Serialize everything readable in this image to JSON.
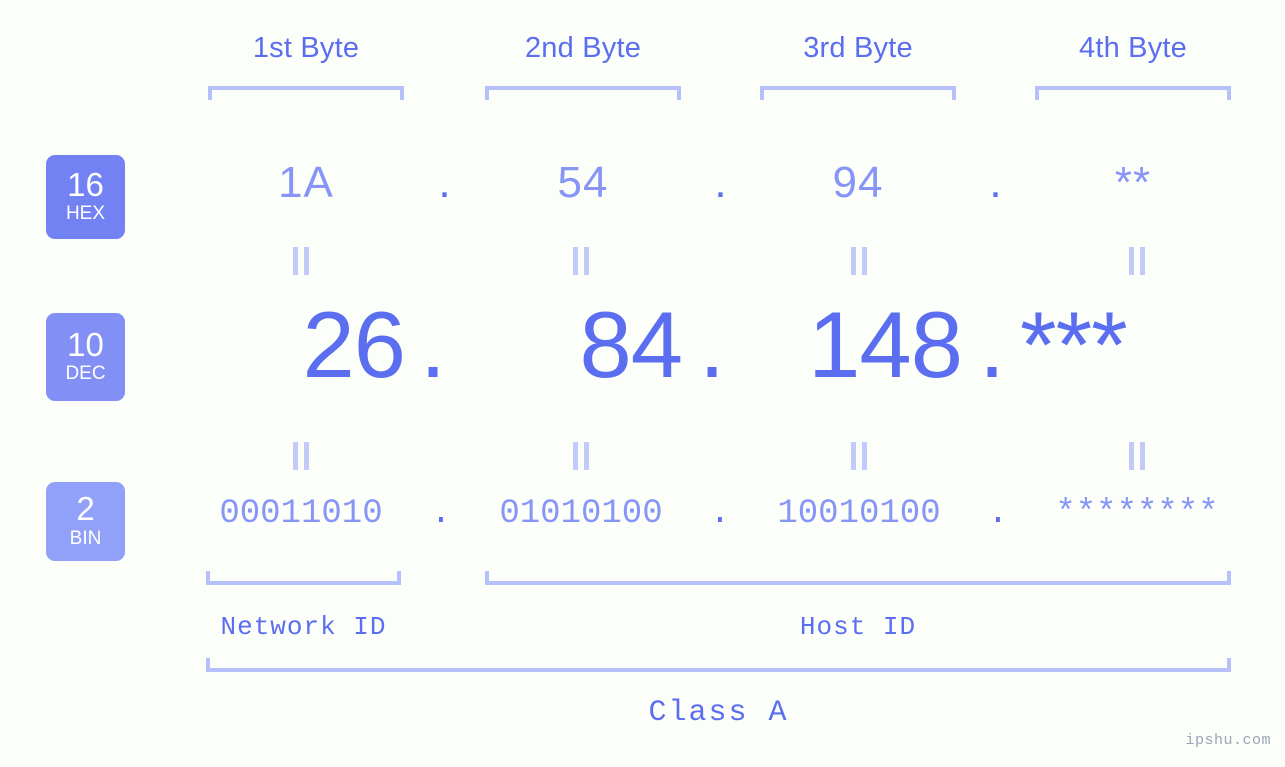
{
  "background_color": "#fcfef9",
  "accent_color": "#5b6ef0",
  "accent_light_color": "#8795f6",
  "bracket_color": "#b6c0fb",
  "headers": {
    "byte1": "1st Byte",
    "byte2": "2nd Byte",
    "byte3": "3rd Byte",
    "byte4": "4th Byte"
  },
  "bases": [
    {
      "number": "16",
      "name": "HEX",
      "color": "#7282f2"
    },
    {
      "number": "10",
      "name": "DEC",
      "color": "#8290f5"
    },
    {
      "number": "2",
      "name": "BIN",
      "color": "#91a0f8"
    }
  ],
  "rows": {
    "hex": {
      "octets": [
        "1A",
        "54",
        "94",
        "**"
      ],
      "separator": "."
    },
    "dec": {
      "octets": [
        "26",
        "84",
        "148",
        "***"
      ],
      "separator": "."
    },
    "bin": {
      "octets": [
        "00011010",
        "01010100",
        "10010100",
        "********"
      ],
      "separator": "."
    }
  },
  "equality_marks": {
    "symbol": "=",
    "count_per_row": 4,
    "rows": 2
  },
  "sections": {
    "network_id": "Network ID",
    "host_id": "Host ID",
    "class": "Class A"
  },
  "watermark": "ipshu.com"
}
